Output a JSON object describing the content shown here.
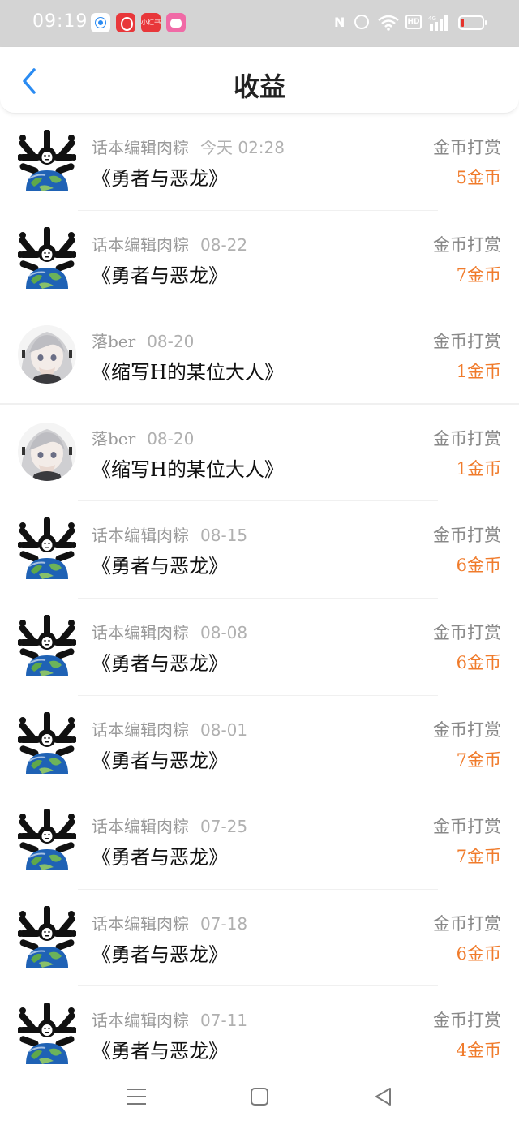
{
  "status_bar": {
    "time": "09:19",
    "apps": [
      "browser-app-icon",
      "netease-music-icon",
      "xiaohongshu-icon",
      "cat-app-icon"
    ],
    "xiaohongshu_label": "小红书",
    "nfc": "N",
    "hd": "HD",
    "network": "4G",
    "battery_color": "#e5322b"
  },
  "header": {
    "title": "收益",
    "back_icon": "chevron-left-icon",
    "accent": "#2a8bf2"
  },
  "rows": [
    {
      "avatar": "cartoon-earth-avatar",
      "name": "话本编辑肉粽",
      "date": "今天 02:28",
      "work": "《勇者与恶龙》",
      "type": "金币打赏",
      "amount": "5金币"
    },
    {
      "avatar": "cartoon-earth-avatar",
      "name": "话本编辑肉粽",
      "date": "08-22",
      "work": "《勇者与恶龙》",
      "type": "金币打赏",
      "amount": "7金币"
    },
    {
      "avatar": "anime-girl-avatar",
      "name": "落ber",
      "date": "08-20",
      "work": "《缩写H的某位大人》",
      "type": "金币打赏",
      "amount": "1金币"
    },
    {
      "avatar": "anime-girl-avatar",
      "name": "落ber",
      "date": "08-20",
      "work": "《缩写H的某位大人》",
      "type": "金币打赏",
      "amount": "1金币"
    },
    {
      "avatar": "cartoon-earth-avatar",
      "name": "话本编辑肉粽",
      "date": "08-15",
      "work": "《勇者与恶龙》",
      "type": "金币打赏",
      "amount": "6金币"
    },
    {
      "avatar": "cartoon-earth-avatar",
      "name": "话本编辑肉粽",
      "date": "08-08",
      "work": "《勇者与恶龙》",
      "type": "金币打赏",
      "amount": "6金币"
    },
    {
      "avatar": "cartoon-earth-avatar",
      "name": "话本编辑肉粽",
      "date": "08-01",
      "work": "《勇者与恶龙》",
      "type": "金币打赏",
      "amount": "7金币"
    },
    {
      "avatar": "cartoon-earth-avatar",
      "name": "话本编辑肉粽",
      "date": "07-25",
      "work": "《勇者与恶龙》",
      "type": "金币打赏",
      "amount": "7金币"
    },
    {
      "avatar": "cartoon-earth-avatar",
      "name": "话本编辑肉粽",
      "date": "07-18",
      "work": "《勇者与恶龙》",
      "type": "金币打赏",
      "amount": "6金币"
    },
    {
      "avatar": "cartoon-earth-avatar",
      "name": "话本编辑肉粽",
      "date": "07-11",
      "work": "《勇者与恶龙》",
      "type": "金币打赏",
      "amount": "4金币"
    }
  ],
  "nav_bar": {
    "menu_icon": "menu-icon",
    "home_icon": "home-square-icon",
    "back_icon": "back-triangle-icon"
  },
  "colors": {
    "amount": "#f07b2b",
    "meta": "#9a9a9a",
    "status_bar_bg": "#d4d4d4"
  }
}
